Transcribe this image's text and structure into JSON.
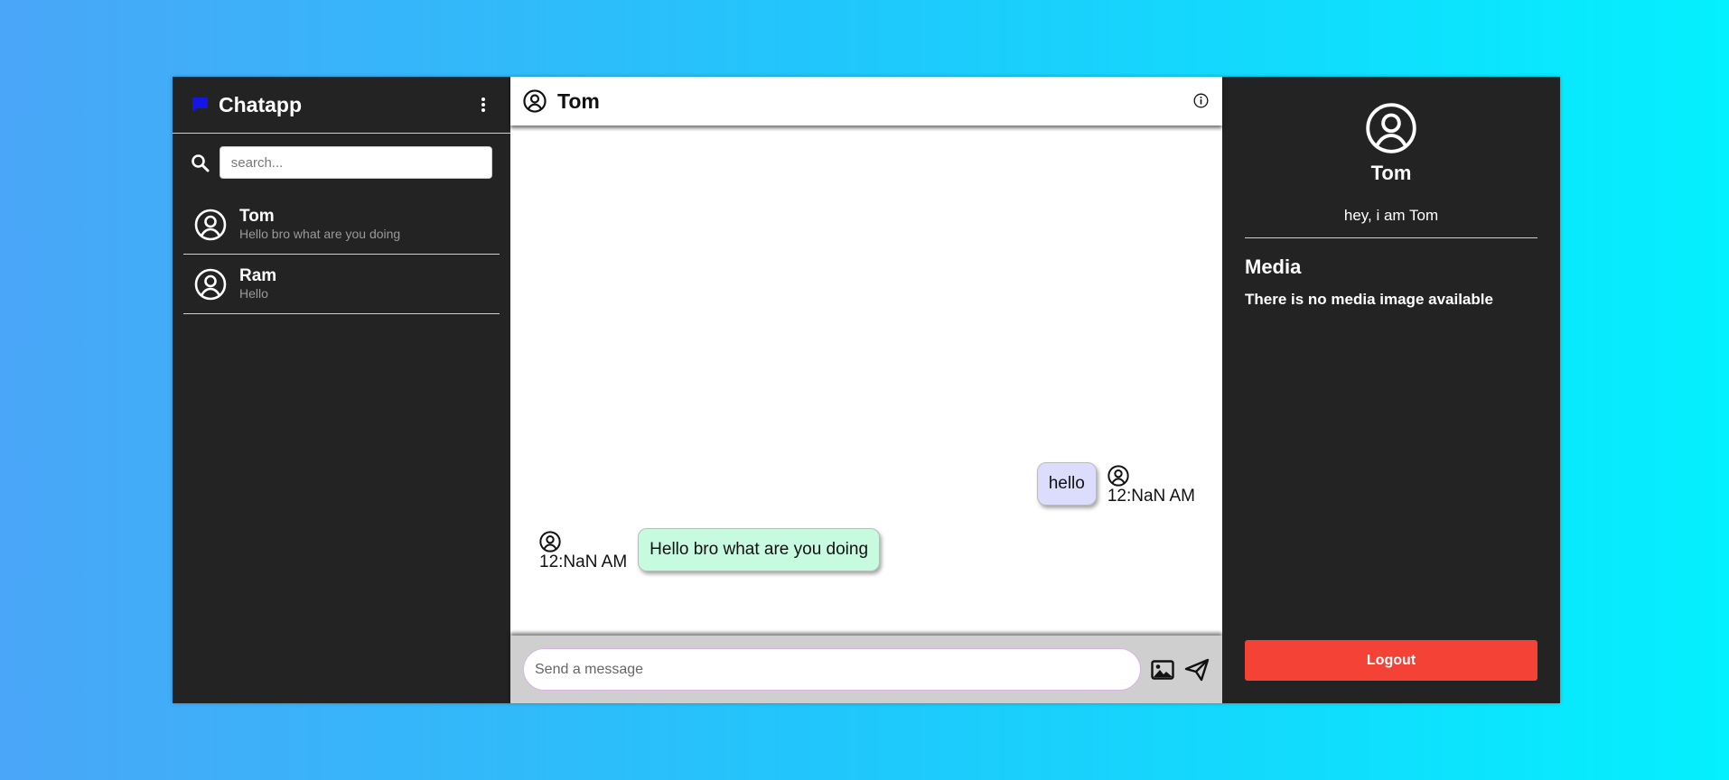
{
  "sidebar": {
    "brand": "Chatapp",
    "brand_icon": "chat-bubble-icon",
    "menu_icon": "kebab-menu-icon",
    "search": {
      "placeholder": "search...",
      "value": ""
    },
    "contacts": [
      {
        "name": "Tom",
        "last_message": "Hello bro what are you doing"
      },
      {
        "name": "Ram",
        "last_message": "Hello"
      }
    ]
  },
  "chat": {
    "title": "Tom",
    "messages": [
      {
        "direction": "out",
        "text": "hello",
        "time": "12:NaN AM"
      },
      {
        "direction": "in",
        "text": "Hello bro what are you doing",
        "time": "12:NaN AM"
      }
    ],
    "composer": {
      "placeholder": "Send a message",
      "value": ""
    }
  },
  "profile": {
    "name": "Tom",
    "bio": "hey, i am Tom",
    "media_title": "Media",
    "media_empty": "There is no media image available",
    "logout_label": "Logout"
  },
  "colors": {
    "panel_bg": "#232323",
    "brand_icon": "#1515e6",
    "outgoing_bubble": "#dcdcfc",
    "incoming_bubble": "#c6fbe0",
    "logout": "#f44336"
  }
}
